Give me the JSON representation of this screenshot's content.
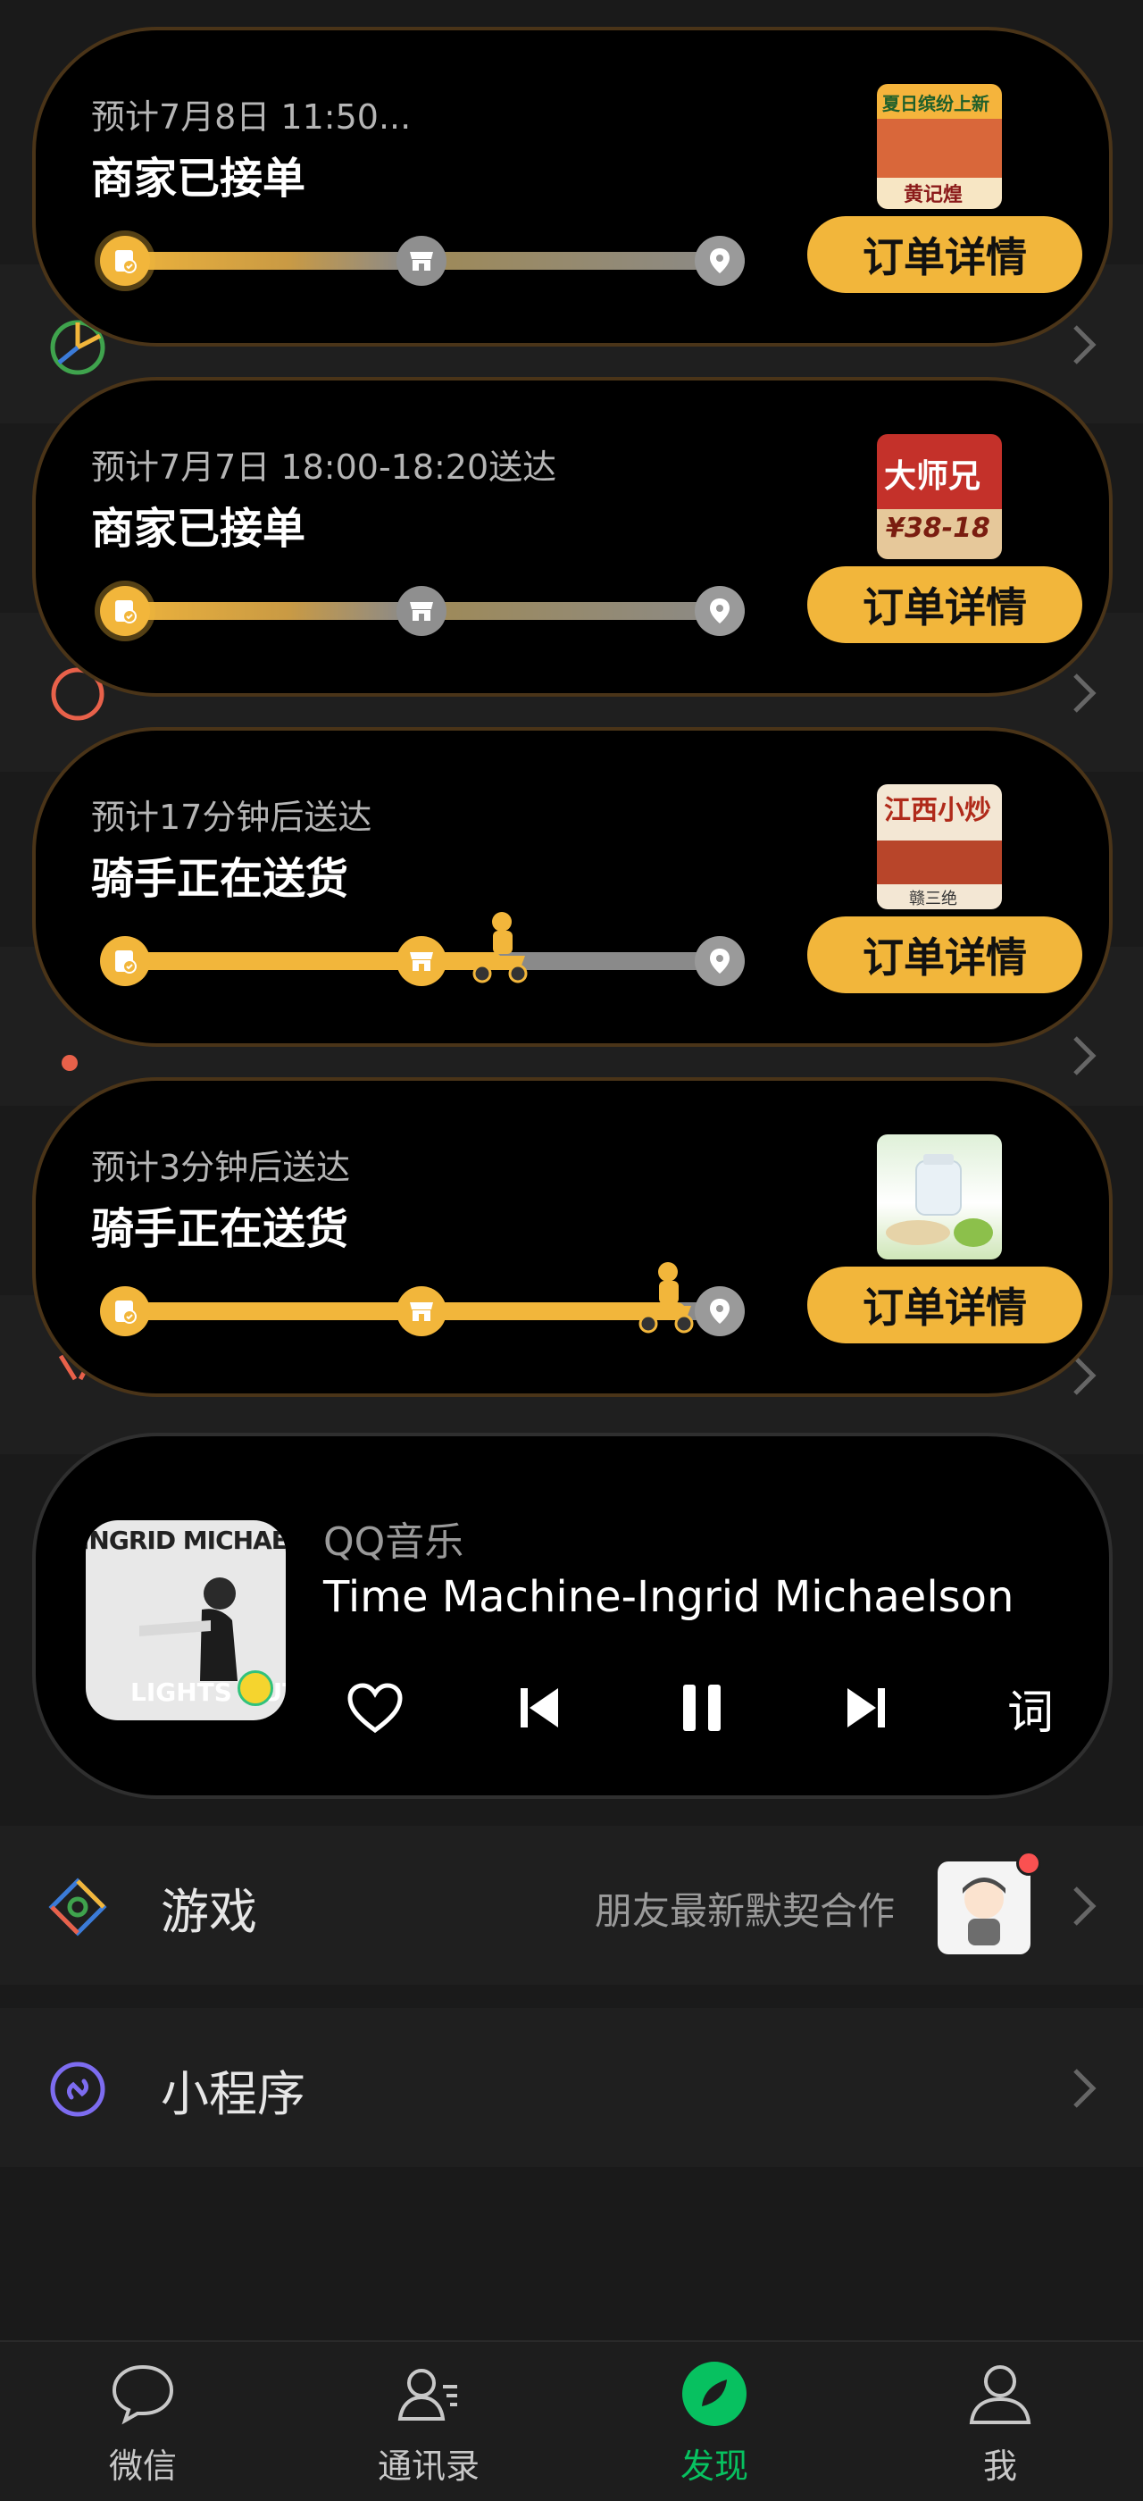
{
  "orders": [
    {
      "eta": "预计7月8日 11:50...",
      "status": "商家已接单",
      "button": "订单详情",
      "progress": 0.0
    },
    {
      "eta": "预计7月7日 18:00-18:20送达",
      "status": "商家已接单",
      "button": "订单详情",
      "progress": 0.0
    },
    {
      "eta": "预计17分钟后送达",
      "status": "骑手正在送货",
      "button": "订单详情",
      "progress": 0.62
    },
    {
      "eta": "预计3分钟后送达",
      "status": "骑手正在送货",
      "button": "订单详情",
      "progress": 0.92
    }
  ],
  "thumbs": {
    "t1_banner": "夏日缤纷上新",
    "t1_brand": "黄记煌",
    "t2_brand": "大师兄",
    "t2_price": "¥38-18",
    "t3_brand": "江西小炒",
    "t3_sub": "赣三绝"
  },
  "music": {
    "source": "QQ音乐",
    "title": "Time Machine-Ingrid Michaelson",
    "cover_artist": "INGRID MICHAELSON",
    "cover_album": "LIGHTS OUT",
    "lyric_label": "词"
  },
  "list": {
    "games_label": "游戏",
    "games_hint": "朋友最新默契合作",
    "mini_label": "小程序"
  },
  "tabs": [
    {
      "label": "微信"
    },
    {
      "label": "通讯录"
    },
    {
      "label": "发现"
    },
    {
      "label": "我"
    }
  ],
  "colors": {
    "accent": "#f2b63b",
    "wechat_green": "#07c160",
    "badge_red": "#fa5151"
  }
}
